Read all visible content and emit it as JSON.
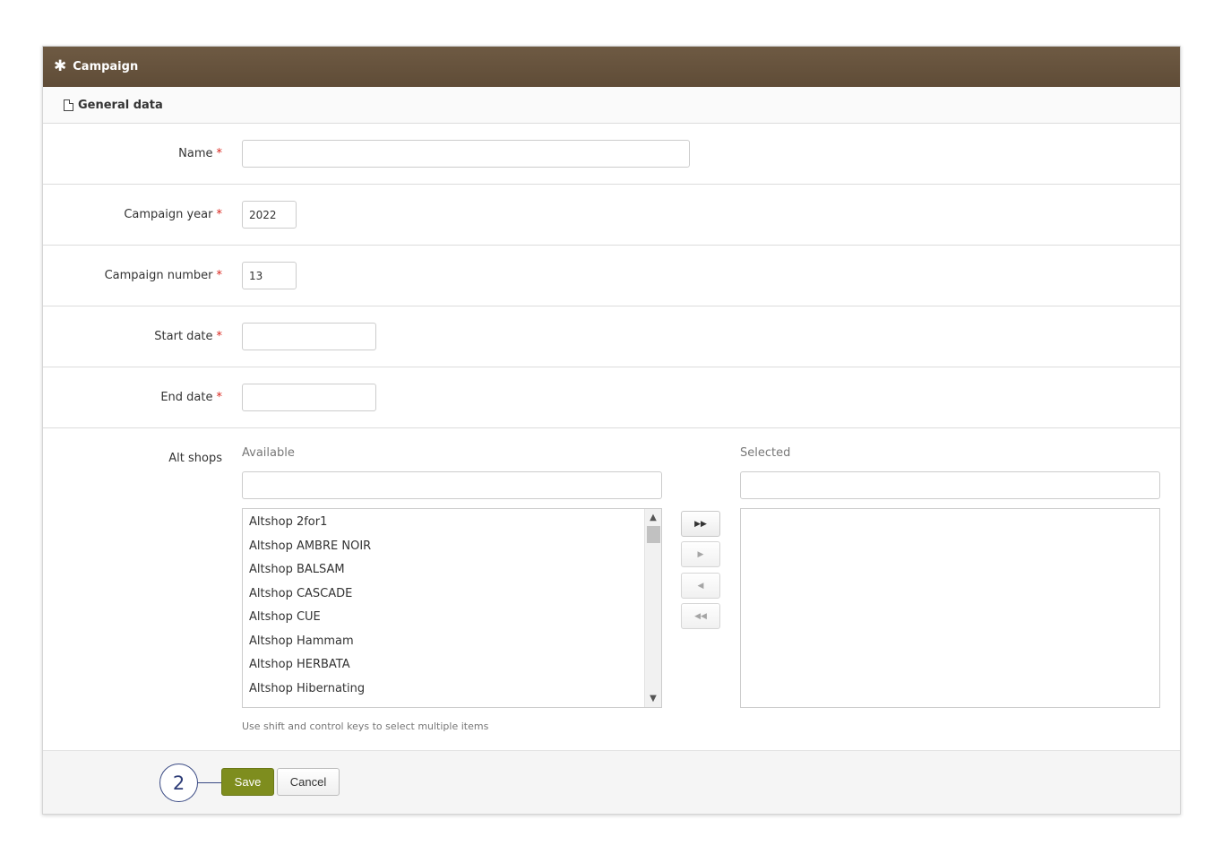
{
  "header": {
    "icon": "asterisk-icon",
    "title": "Campaign"
  },
  "section": {
    "icon": "document-icon",
    "title": "General data"
  },
  "form": {
    "required_marker": "*",
    "name": {
      "label": "Name",
      "value": ""
    },
    "campaign_year": {
      "label": "Campaign year",
      "value": "2022"
    },
    "campaign_number": {
      "label": "Campaign number",
      "value": "13"
    },
    "start_date": {
      "label": "Start date",
      "value": ""
    },
    "end_date": {
      "label": "End date",
      "value": ""
    }
  },
  "alt_shops": {
    "label": "Alt shops",
    "available_title": "Available",
    "selected_title": "Selected",
    "available_items": [
      "Altshop 2for1",
      "Altshop AMBRE NOIR",
      "Altshop BALSAM",
      "Altshop CASCADE",
      "Altshop CUE",
      "Altshop Hammam",
      "Altshop HERBATA",
      "Altshop Hibernating"
    ],
    "selected_items": [],
    "buttons": {
      "move_all_right": "double-chevron-right-icon",
      "move_right": "chevron-right-icon",
      "move_left": "chevron-left-icon",
      "move_all_left": "double-chevron-left-icon"
    },
    "hint": "Use shift and control keys to select multiple items"
  },
  "footer": {
    "callout_number": "2",
    "save_label": "Save",
    "cancel_label": "Cancel"
  },
  "colors": {
    "header_bg": "#65523d",
    "save_bg": "#7e8d1e",
    "required": "#d9251d",
    "callout": "#3a4a84"
  }
}
